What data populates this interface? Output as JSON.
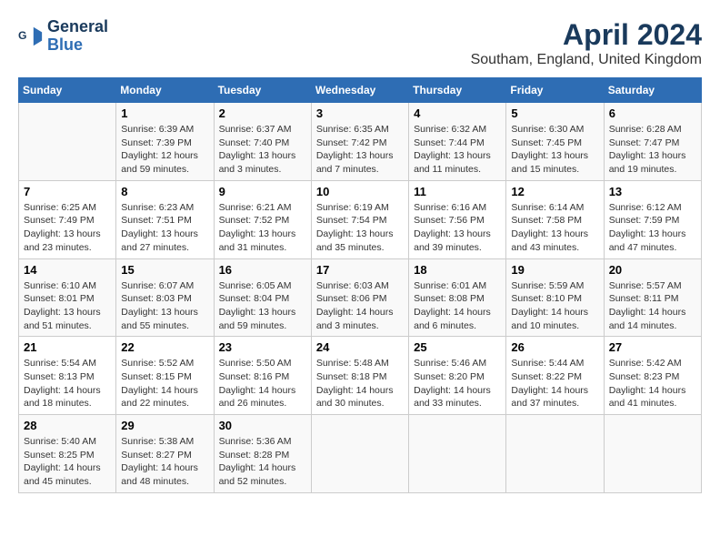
{
  "logo": {
    "line1": "General",
    "line2": "Blue"
  },
  "title": "April 2024",
  "subtitle": "Southam, England, United Kingdom",
  "days_of_week": [
    "Sunday",
    "Monday",
    "Tuesday",
    "Wednesday",
    "Thursday",
    "Friday",
    "Saturday"
  ],
  "weeks": [
    [
      {
        "day": "",
        "info": ""
      },
      {
        "day": "1",
        "info": "Sunrise: 6:39 AM\nSunset: 7:39 PM\nDaylight: 12 hours\nand 59 minutes."
      },
      {
        "day": "2",
        "info": "Sunrise: 6:37 AM\nSunset: 7:40 PM\nDaylight: 13 hours\nand 3 minutes."
      },
      {
        "day": "3",
        "info": "Sunrise: 6:35 AM\nSunset: 7:42 PM\nDaylight: 13 hours\nand 7 minutes."
      },
      {
        "day": "4",
        "info": "Sunrise: 6:32 AM\nSunset: 7:44 PM\nDaylight: 13 hours\nand 11 minutes."
      },
      {
        "day": "5",
        "info": "Sunrise: 6:30 AM\nSunset: 7:45 PM\nDaylight: 13 hours\nand 15 minutes."
      },
      {
        "day": "6",
        "info": "Sunrise: 6:28 AM\nSunset: 7:47 PM\nDaylight: 13 hours\nand 19 minutes."
      }
    ],
    [
      {
        "day": "7",
        "info": "Sunrise: 6:25 AM\nSunset: 7:49 PM\nDaylight: 13 hours\nand 23 minutes."
      },
      {
        "day": "8",
        "info": "Sunrise: 6:23 AM\nSunset: 7:51 PM\nDaylight: 13 hours\nand 27 minutes."
      },
      {
        "day": "9",
        "info": "Sunrise: 6:21 AM\nSunset: 7:52 PM\nDaylight: 13 hours\nand 31 minutes."
      },
      {
        "day": "10",
        "info": "Sunrise: 6:19 AM\nSunset: 7:54 PM\nDaylight: 13 hours\nand 35 minutes."
      },
      {
        "day": "11",
        "info": "Sunrise: 6:16 AM\nSunset: 7:56 PM\nDaylight: 13 hours\nand 39 minutes."
      },
      {
        "day": "12",
        "info": "Sunrise: 6:14 AM\nSunset: 7:58 PM\nDaylight: 13 hours\nand 43 minutes."
      },
      {
        "day": "13",
        "info": "Sunrise: 6:12 AM\nSunset: 7:59 PM\nDaylight: 13 hours\nand 47 minutes."
      }
    ],
    [
      {
        "day": "14",
        "info": "Sunrise: 6:10 AM\nSunset: 8:01 PM\nDaylight: 13 hours\nand 51 minutes."
      },
      {
        "day": "15",
        "info": "Sunrise: 6:07 AM\nSunset: 8:03 PM\nDaylight: 13 hours\nand 55 minutes."
      },
      {
        "day": "16",
        "info": "Sunrise: 6:05 AM\nSunset: 8:04 PM\nDaylight: 13 hours\nand 59 minutes."
      },
      {
        "day": "17",
        "info": "Sunrise: 6:03 AM\nSunset: 8:06 PM\nDaylight: 14 hours\nand 3 minutes."
      },
      {
        "day": "18",
        "info": "Sunrise: 6:01 AM\nSunset: 8:08 PM\nDaylight: 14 hours\nand 6 minutes."
      },
      {
        "day": "19",
        "info": "Sunrise: 5:59 AM\nSunset: 8:10 PM\nDaylight: 14 hours\nand 10 minutes."
      },
      {
        "day": "20",
        "info": "Sunrise: 5:57 AM\nSunset: 8:11 PM\nDaylight: 14 hours\nand 14 minutes."
      }
    ],
    [
      {
        "day": "21",
        "info": "Sunrise: 5:54 AM\nSunset: 8:13 PM\nDaylight: 14 hours\nand 18 minutes."
      },
      {
        "day": "22",
        "info": "Sunrise: 5:52 AM\nSunset: 8:15 PM\nDaylight: 14 hours\nand 22 minutes."
      },
      {
        "day": "23",
        "info": "Sunrise: 5:50 AM\nSunset: 8:16 PM\nDaylight: 14 hours\nand 26 minutes."
      },
      {
        "day": "24",
        "info": "Sunrise: 5:48 AM\nSunset: 8:18 PM\nDaylight: 14 hours\nand 30 minutes."
      },
      {
        "day": "25",
        "info": "Sunrise: 5:46 AM\nSunset: 8:20 PM\nDaylight: 14 hours\nand 33 minutes."
      },
      {
        "day": "26",
        "info": "Sunrise: 5:44 AM\nSunset: 8:22 PM\nDaylight: 14 hours\nand 37 minutes."
      },
      {
        "day": "27",
        "info": "Sunrise: 5:42 AM\nSunset: 8:23 PM\nDaylight: 14 hours\nand 41 minutes."
      }
    ],
    [
      {
        "day": "28",
        "info": "Sunrise: 5:40 AM\nSunset: 8:25 PM\nDaylight: 14 hours\nand 45 minutes."
      },
      {
        "day": "29",
        "info": "Sunrise: 5:38 AM\nSunset: 8:27 PM\nDaylight: 14 hours\nand 48 minutes."
      },
      {
        "day": "30",
        "info": "Sunrise: 5:36 AM\nSunset: 8:28 PM\nDaylight: 14 hours\nand 52 minutes."
      },
      {
        "day": "",
        "info": ""
      },
      {
        "day": "",
        "info": ""
      },
      {
        "day": "",
        "info": ""
      },
      {
        "day": "",
        "info": ""
      }
    ]
  ]
}
